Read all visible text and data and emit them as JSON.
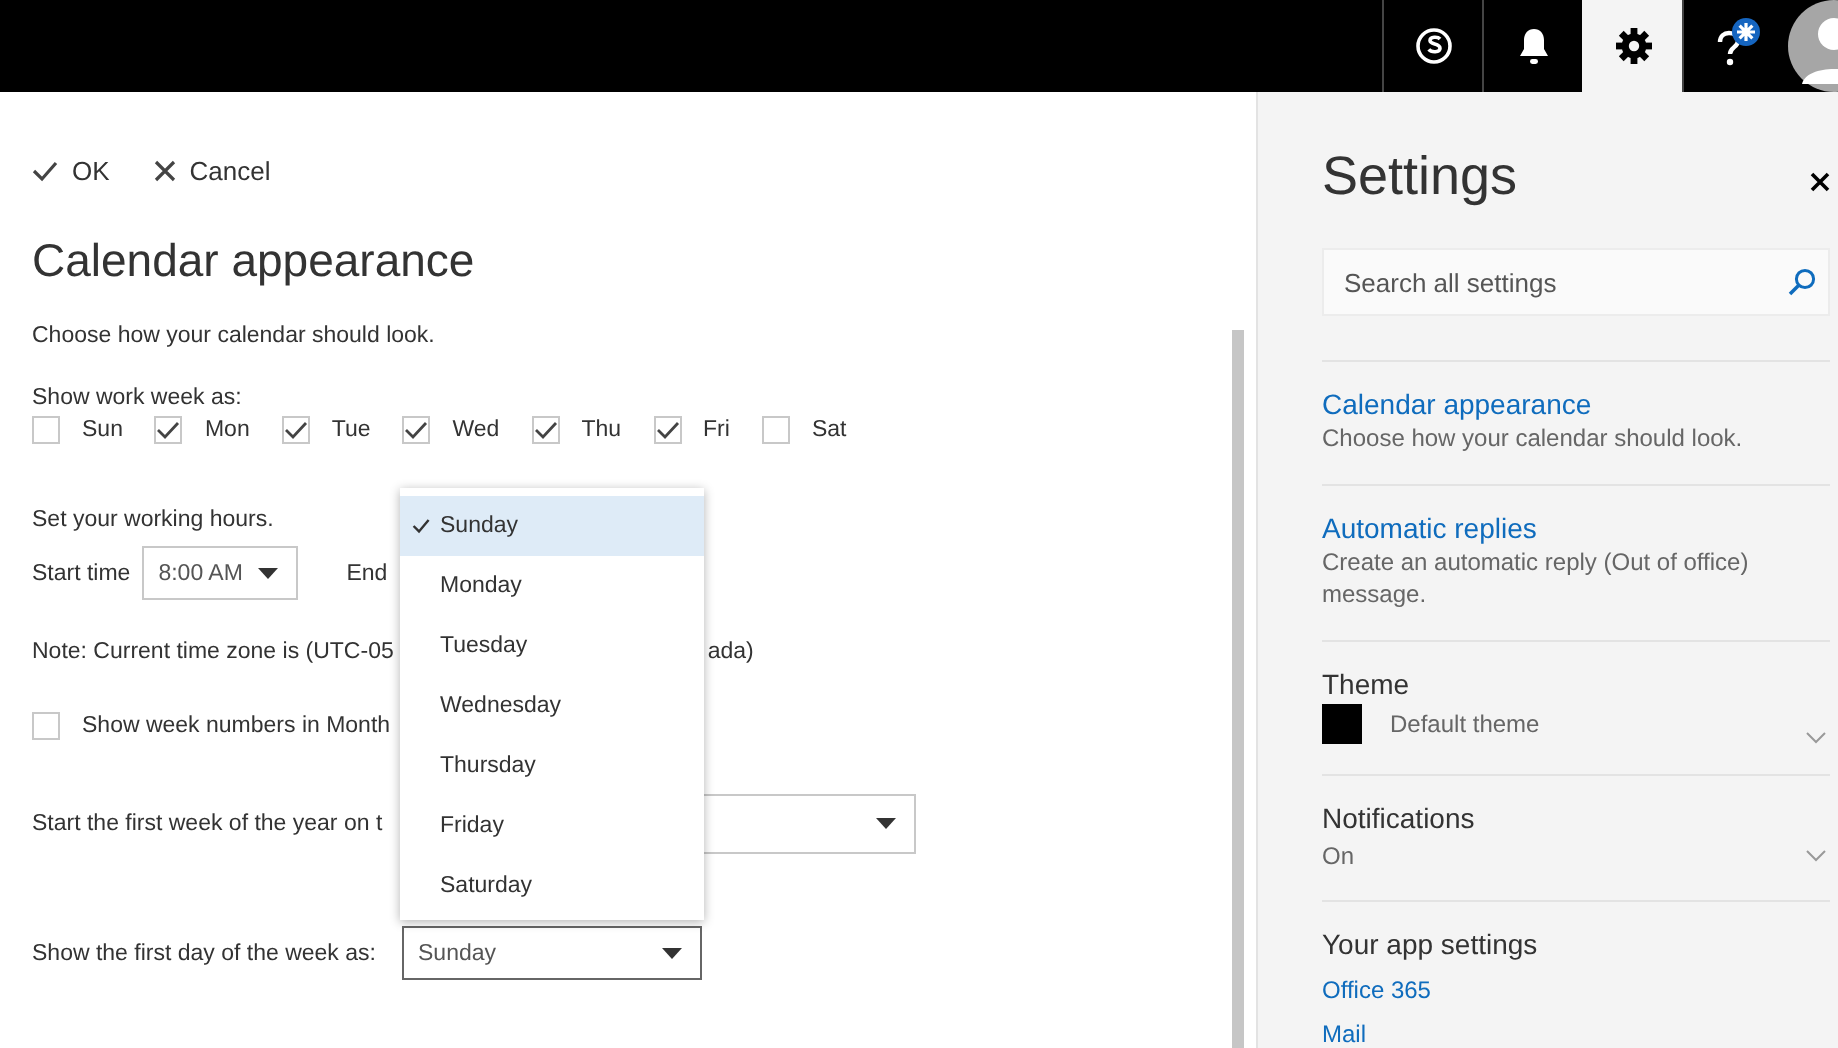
{
  "top_bar": {
    "buttons": [
      {
        "kind": "skype",
        "selected": false
      },
      {
        "kind": "bell",
        "selected": false
      },
      {
        "kind": "gear",
        "selected": true
      },
      {
        "kind": "help",
        "selected": false
      }
    ]
  },
  "form": {
    "actions": [
      {
        "kind": "ok",
        "label": "OK"
      },
      {
        "kind": "cancel",
        "label": "Cancel"
      }
    ],
    "title": "Calendar appearance",
    "description": "Choose how your calendar should look.",
    "work_week": {
      "label": "Show work week as:",
      "days": [
        {
          "label": "Sun",
          "checked": false
        },
        {
          "label": "Mon",
          "checked": true
        },
        {
          "label": "Tue",
          "checked": true
        },
        {
          "label": "Wed",
          "checked": true
        },
        {
          "label": "Thu",
          "checked": true
        },
        {
          "label": "Fri",
          "checked": true
        },
        {
          "label": "Sat",
          "checked": false
        }
      ]
    },
    "working_hours": {
      "label": "Set your working hours.",
      "start_label": "Start time",
      "start_value": "8:00 AM",
      "end_label": "End"
    },
    "timezone_note": {
      "text": "Note: Current time zone is (UTC-05",
      "tail": "ada)"
    },
    "week_numbers": {
      "label": "Show week numbers in Month",
      "checked": false
    },
    "first_week": {
      "label": "Start the first week of the year on t"
    },
    "first_day": {
      "label": "Show the first day of the week as:",
      "value": "Sunday"
    },
    "dropdown": {
      "options": [
        {
          "label": "Sunday",
          "selected": true
        },
        {
          "label": "Monday",
          "selected": false
        },
        {
          "label": "Tuesday",
          "selected": false
        },
        {
          "label": "Wednesday",
          "selected": false
        },
        {
          "label": "Thursday",
          "selected": false
        },
        {
          "label": "Friday",
          "selected": false
        },
        {
          "label": "Saturday",
          "selected": false
        }
      ]
    }
  },
  "settings": {
    "title": "Settings",
    "search": {
      "placeholder": "Search all settings"
    },
    "items": [
      {
        "kind": "link",
        "title": "Calendar appearance",
        "description": "Choose how your calendar should look."
      },
      {
        "kind": "link",
        "title": "Automatic replies",
        "description": "Create an automatic reply (Out of office) message."
      },
      {
        "kind": "theme",
        "title": "Theme",
        "value": "Default theme",
        "color": "#000000"
      },
      {
        "kind": "dropdown",
        "title": "Notifications",
        "value": "On"
      }
    ],
    "app_settings": {
      "title": "Your app settings",
      "links": [
        "Office 365",
        "Mail"
      ]
    }
  }
}
